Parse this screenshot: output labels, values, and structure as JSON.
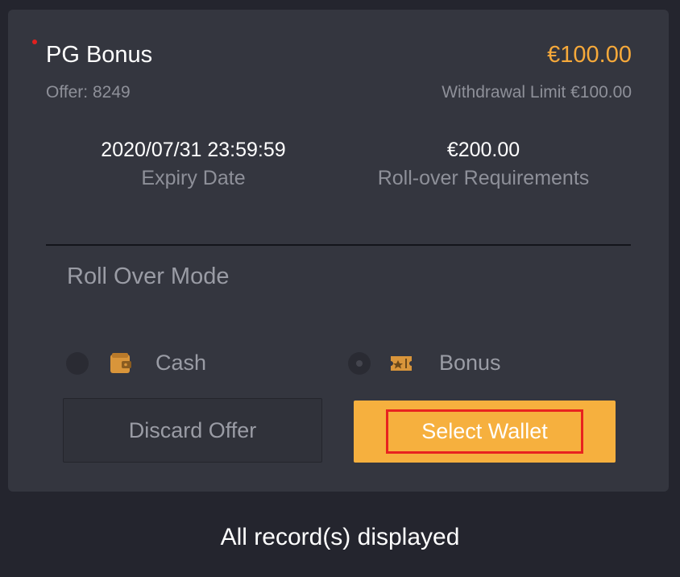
{
  "bonus": {
    "title": "PG Bonus",
    "amount": "€100.00",
    "offer": "Offer: 8249",
    "withdrawal_limit": "Withdrawal Limit €100.00",
    "expiry_value": "2020/07/31 23:59:59",
    "expiry_label": "Expiry Date",
    "rollover_value": "€200.00",
    "rollover_label": "Roll-over Requirements"
  },
  "roll_over_mode": {
    "title": "Roll Over Mode",
    "options": [
      {
        "label": "Cash",
        "icon": "wallet-icon",
        "selected": false
      },
      {
        "label": "Bonus",
        "icon": "ticket-icon",
        "selected": true
      }
    ]
  },
  "actions": {
    "discard_label": "Discard Offer",
    "select_label": "Select Wallet"
  },
  "footer": {
    "status": "All record(s) displayed"
  },
  "colors": {
    "accent": "#f6a93a",
    "button": "#f6b03e",
    "highlight": "#e8231f",
    "card": "#34363f",
    "background": "#24252e"
  }
}
